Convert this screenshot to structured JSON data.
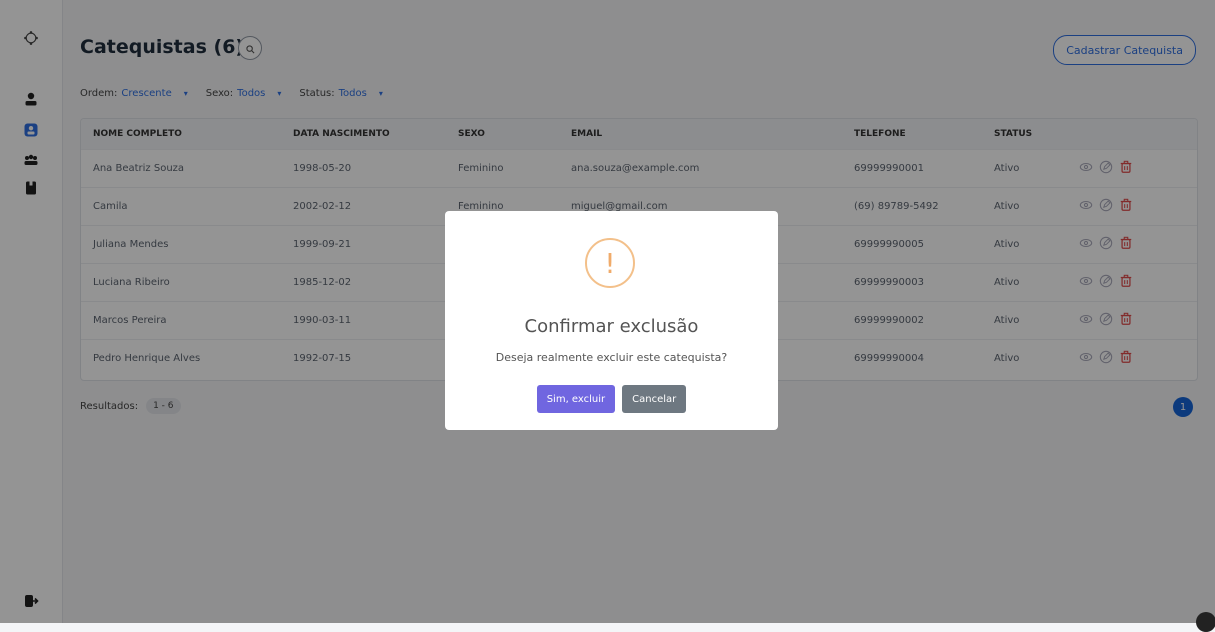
{
  "header": {
    "title": "Catequistas (6)",
    "add_button": "Cadastrar Catequista"
  },
  "filters": [
    {
      "label": "Ordem:",
      "value": "Crescente"
    },
    {
      "label": "Sexo:",
      "value": "Todos"
    },
    {
      "label": "Status:",
      "value": "Todos"
    }
  ],
  "table": {
    "columns": [
      "NOME COMPLETO",
      "DATA NASCIMENTO",
      "SEXO",
      "EMAIL",
      "TELEFONE",
      "STATUS"
    ],
    "rows": [
      [
        "Ana Beatriz Souza",
        "1998-05-20",
        "Feminino",
        "ana.souza@example.com",
        "69999990001",
        "Ativo"
      ],
      [
        "Camila",
        "2002-02-12",
        "Feminino",
        "miguel@gmail.com",
        "(69) 89789-5492",
        "Ativo"
      ],
      [
        "Juliana Mendes",
        "1999-09-21",
        "",
        "",
        "69999990005",
        "Ativo"
      ],
      [
        "Luciana Ribeiro",
        "1985-12-02",
        "",
        "",
        "69999990003",
        "Ativo"
      ],
      [
        "Marcos Pereira",
        "1990-03-11",
        "",
        "",
        "69999990002",
        "Ativo"
      ],
      [
        "Pedro Henrique Alves",
        "1992-07-15",
        "",
        "",
        "69999990004",
        "Ativo"
      ]
    ]
  },
  "footer": {
    "results_label": "Resultados:",
    "results_range": "1 - 6",
    "page": "1"
  },
  "modal": {
    "icon": "!",
    "title": "Confirmar exclusão",
    "text": "Deseja realmente excluir este catequista?",
    "confirm": "Sim, excluir",
    "cancel": "Cancelar"
  },
  "colors": {
    "accent": "#2f6fe0",
    "confirm": "#7066e0",
    "cancel": "#6e7881",
    "warning": "#f0ab6a",
    "delete": "#e04b4b"
  }
}
